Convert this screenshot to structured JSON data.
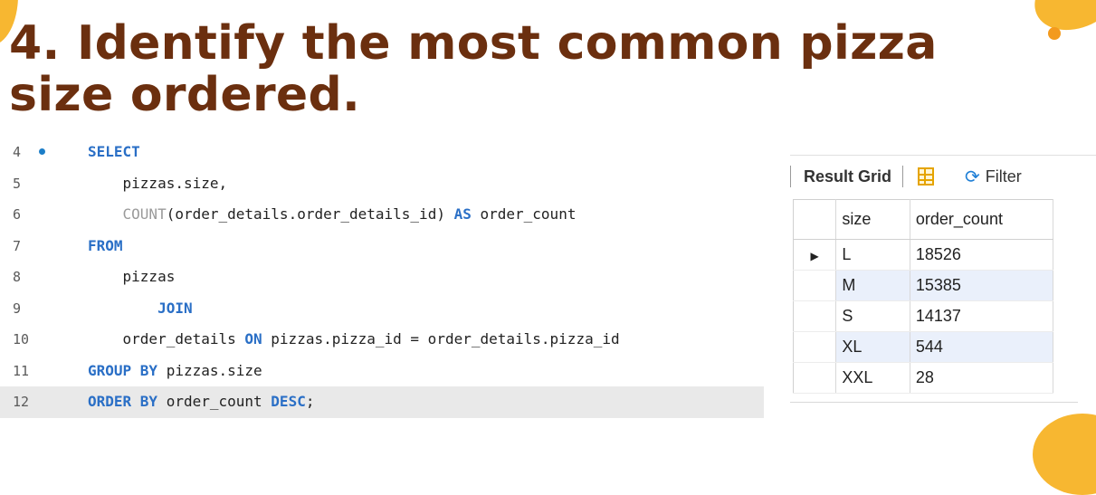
{
  "title": "4. Identify the most common pizza size ordered.",
  "code": {
    "lines": [
      {
        "num": "4",
        "tokens": [
          {
            "t": "SELECT",
            "k": "kw"
          }
        ]
      },
      {
        "num": "5",
        "tokens": [
          {
            "t": "    pizzas.size,",
            "k": "plain"
          }
        ]
      },
      {
        "num": "6",
        "tokens": [
          {
            "t": "    COUNT",
            "k": "fn"
          },
          {
            "t": "(order_details.order_details_id) ",
            "k": "plain"
          },
          {
            "t": "AS",
            "k": "kw"
          },
          {
            "t": " order_count",
            "k": "plain"
          }
        ]
      },
      {
        "num": "7",
        "tokens": [
          {
            "t": "FROM",
            "k": "kw"
          }
        ]
      },
      {
        "num": "8",
        "tokens": [
          {
            "t": "    pizzas",
            "k": "plain"
          }
        ]
      },
      {
        "num": "9",
        "tokens": [
          {
            "t": "        JOIN",
            "k": "kw"
          }
        ]
      },
      {
        "num": "10",
        "tokens": [
          {
            "t": "    order_details ",
            "k": "plain"
          },
          {
            "t": "ON",
            "k": "kw"
          },
          {
            "t": " pizzas.pizza_id = order_details.pizza_id",
            "k": "plain"
          }
        ]
      },
      {
        "num": "11",
        "tokens": [
          {
            "t": "GROUP BY",
            "k": "kw"
          },
          {
            "t": " pizzas.size",
            "k": "plain"
          }
        ]
      },
      {
        "num": "12",
        "tokens": [
          {
            "t": "ORDER BY",
            "k": "kw"
          },
          {
            "t": " order_count ",
            "k": "plain"
          },
          {
            "t": "DESC",
            "k": "kw"
          },
          {
            "t": ";",
            "k": "plain"
          }
        ]
      }
    ]
  },
  "result": {
    "toolbar": {
      "label": "Result Grid",
      "filter": "Filter"
    },
    "columns": [
      "size",
      "order_count"
    ],
    "rows": [
      [
        "L",
        "18526"
      ],
      [
        "M",
        "15385"
      ],
      [
        "S",
        "14137"
      ],
      [
        "XL",
        "544"
      ],
      [
        "XXL",
        "28"
      ]
    ]
  }
}
